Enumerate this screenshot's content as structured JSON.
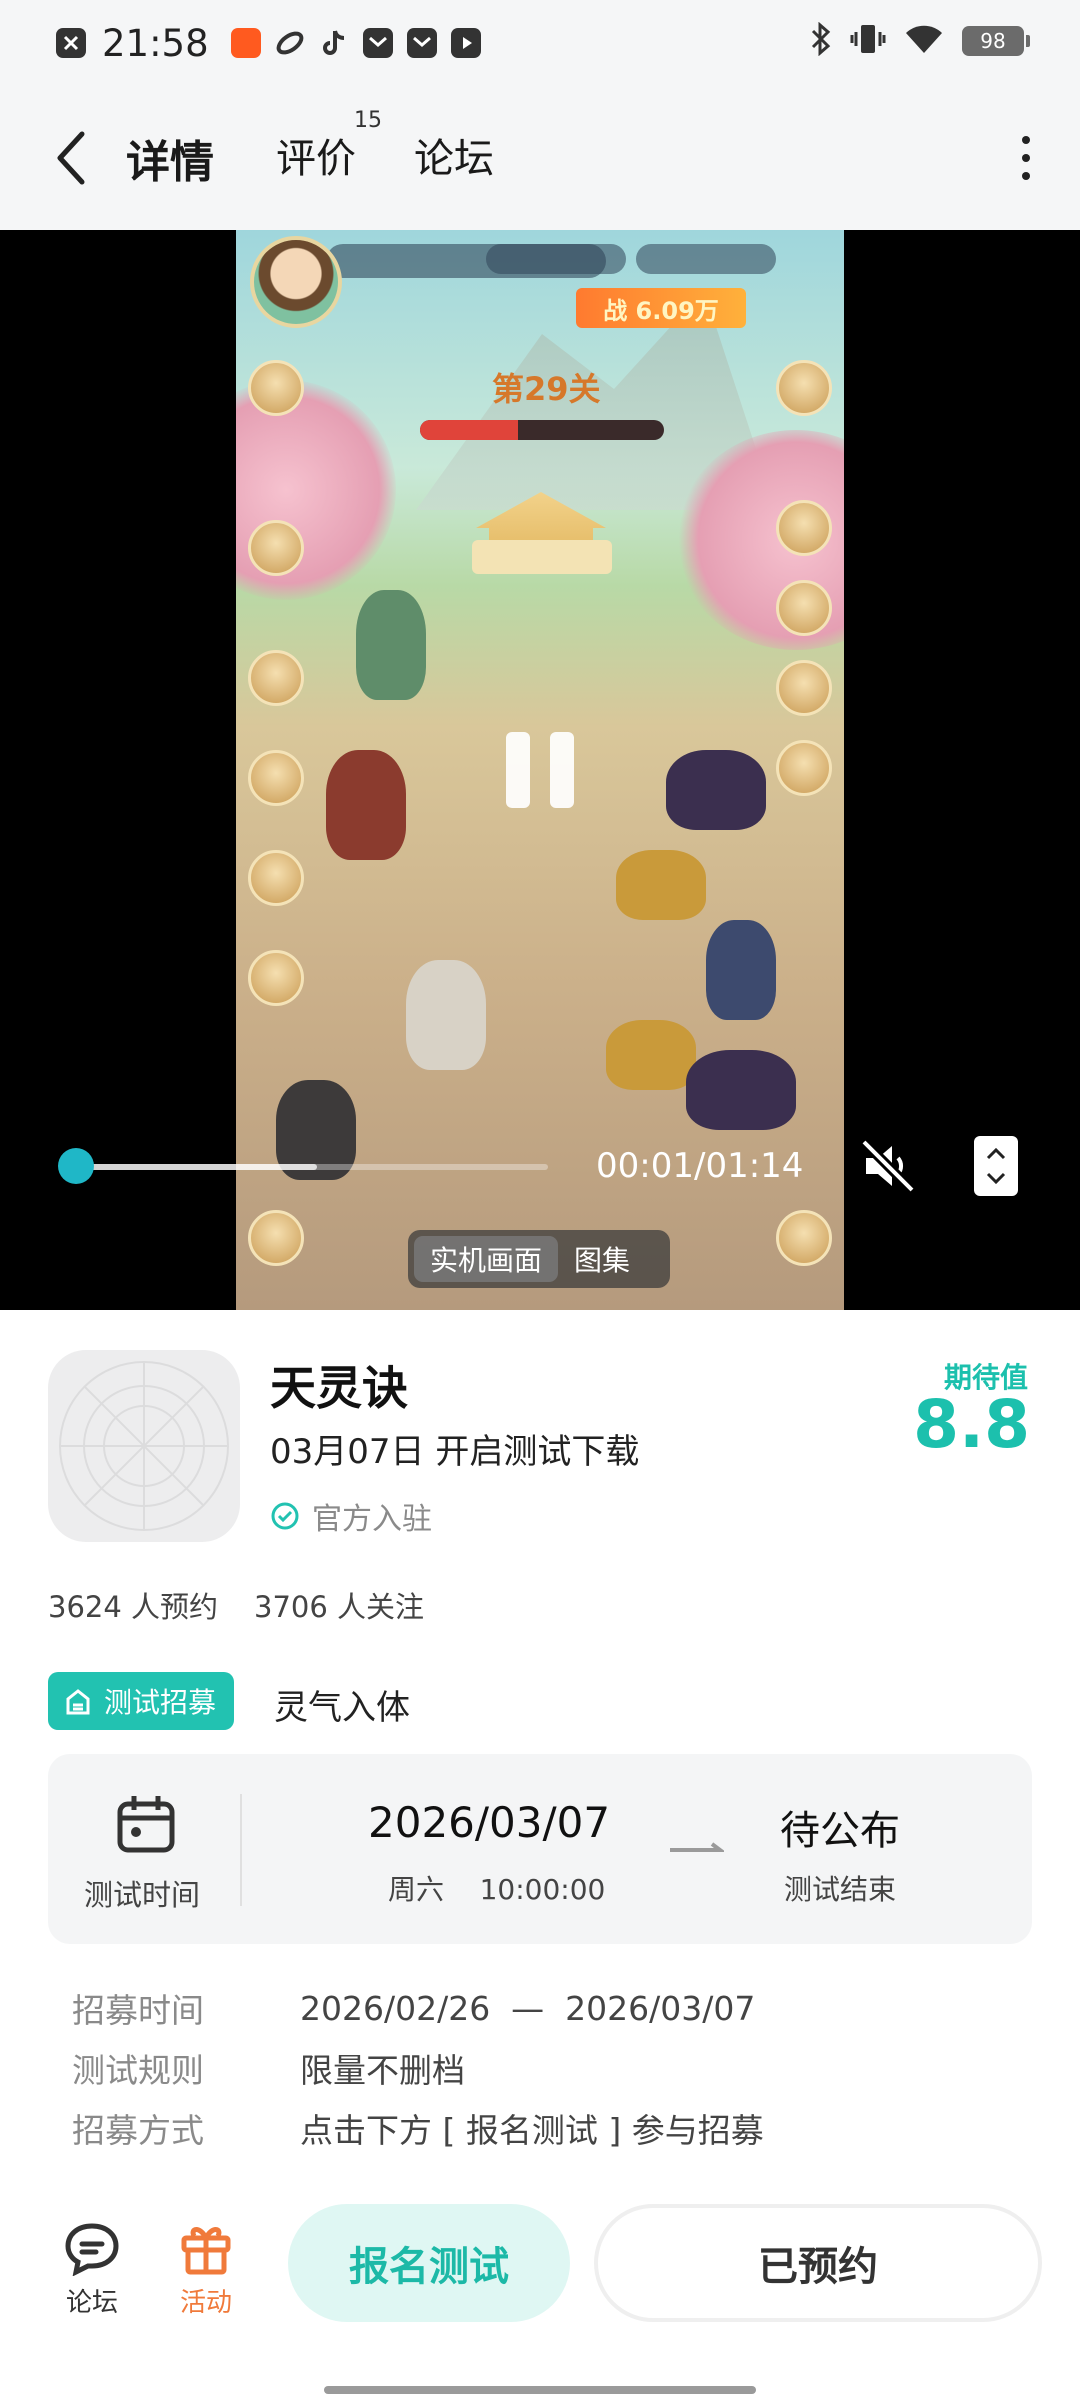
{
  "status_bar": {
    "time": "21:58",
    "battery": "98",
    "icons_left": [
      "close-notification-icon",
      "taobao-icon",
      "browser-icon",
      "tiktok-icon",
      "mail-icon",
      "mail-icon",
      "video-icon"
    ],
    "icons_right": [
      "bluetooth-icon",
      "vibrate-icon",
      "wifi-icon",
      "battery-icon"
    ]
  },
  "header": {
    "tabs": [
      {
        "label": "详情",
        "active": true
      },
      {
        "label": "评价",
        "badge": "15"
      },
      {
        "label": "论坛"
      }
    ],
    "accent": "#23c8b8"
  },
  "video": {
    "time": "00:01/01:14",
    "progress": 0.02,
    "buffered": 0.52,
    "muted": true,
    "media_tabs": [
      {
        "label": "实机画面",
        "active": true
      },
      {
        "label": "图集"
      }
    ],
    "game_hud": {
      "stage": "第29关",
      "power": "战 6.09万"
    }
  },
  "game": {
    "name": "天灵诀",
    "test_date_text": "03月07日  开启测试下载",
    "official": "官方入驻",
    "expectation_label": "期待值",
    "expectation_score": "8.8",
    "reservations": "3624  人预约",
    "followers": "3706  人关注"
  },
  "recruit": {
    "tag": "测试招募",
    "title": "灵气入体"
  },
  "test_card": {
    "label": "测试时间",
    "start_date": "2026/03/07",
    "start_sub": "周六    10:00:00",
    "end_value": "待公布",
    "end_label": "测试结束"
  },
  "rules": [
    {
      "key": "招募时间",
      "value": "2026/02/26  —  2026/03/07"
    },
    {
      "key": "测试规则",
      "value": "限量不删档"
    },
    {
      "key": "招募方式",
      "value": "点击下方 [ 报名测试 ] 参与招募"
    }
  ],
  "bottom_bar": {
    "forum": "论坛",
    "activity": "活动",
    "signup": "报名测试",
    "reserved": "已预约",
    "activity_color": "#f07a3b"
  }
}
